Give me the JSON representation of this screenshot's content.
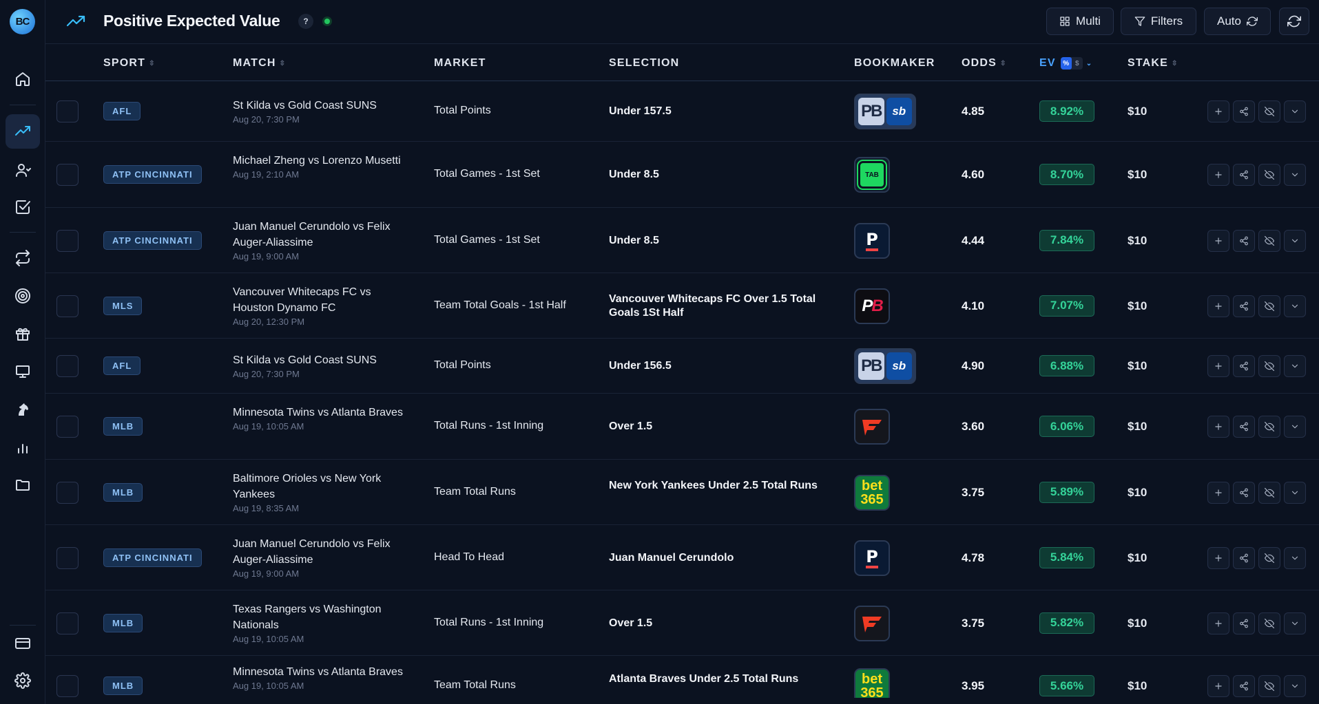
{
  "app": {
    "logo_text": "BC"
  },
  "header": {
    "title": "Positive Expected Value",
    "help_label": "?",
    "buttons": {
      "multi": "Multi",
      "filters": "Filters",
      "auto": "Auto"
    }
  },
  "sidebar": {
    "items": [
      {
        "icon": "home-icon",
        "active": false
      },
      {
        "icon": "trending-up-icon",
        "active": true
      },
      {
        "icon": "user-icon",
        "active": false
      },
      {
        "icon": "check-square-icon",
        "active": false
      },
      {
        "icon": "repeat-icon",
        "active": false
      },
      {
        "icon": "target-icon",
        "active": false
      },
      {
        "icon": "gift-icon",
        "active": false
      },
      {
        "icon": "monitor-icon",
        "active": false
      },
      {
        "icon": "horse-icon",
        "active": false
      },
      {
        "icon": "bar-chart-icon",
        "active": false
      },
      {
        "icon": "folder-icon",
        "active": false
      }
    ],
    "bottom": [
      {
        "icon": "credit-card-icon"
      },
      {
        "icon": "settings-icon"
      }
    ]
  },
  "table": {
    "columns": {
      "sport": "SPORT",
      "match": "MATCH",
      "market": "MARKET",
      "selection": "SELECTION",
      "bookmaker": "BOOKMAKER",
      "odds": "ODDS",
      "ev": "EV",
      "stake": "STAKE"
    },
    "ev_toggle": {
      "percent": "%",
      "dollar": "$"
    },
    "rows": [
      {
        "sport": "AFL",
        "match": "St Kilda vs Gold Coast SUNS",
        "time": "Aug 20, 7:30 PM",
        "market": "Total Points",
        "selection": "Under 157.5",
        "bookmaker": "pointsbet-sportsbet",
        "odds": "4.85",
        "ev": "8.92%",
        "stake": "$10"
      },
      {
        "sport": "ATP CINCINNATI",
        "match": "Michael Zheng vs Lorenzo Musetti",
        "time": "Aug 19, 2:10 AM",
        "market": "Total Games - 1st Set",
        "selection": "Under 8.5",
        "bookmaker": "tab",
        "odds": "4.60",
        "ev": "8.70%",
        "stake": "$10"
      },
      {
        "sport": "ATP CINCINNATI",
        "match": "Juan Manuel Cerundolo vs Felix Auger-Aliassime",
        "time": "Aug 19, 9:00 AM",
        "market": "Total Games - 1st Set",
        "selection": "Under 8.5",
        "bookmaker": "p",
        "odds": "4.44",
        "ev": "7.84%",
        "stake": "$10"
      },
      {
        "sport": "MLS",
        "match": "Vancouver Whitecaps FC vs Houston Dynamo FC",
        "time": "Aug 20, 12:30 PM",
        "market": "Team Total Goals - 1st Half",
        "selection": "Vancouver Whitecaps FC Over 1.5 Total Goals 1St Half",
        "bookmaker": "pb",
        "odds": "4.10",
        "ev": "7.07%",
        "stake": "$10"
      },
      {
        "sport": "AFL",
        "match": "St Kilda vs Gold Coast SUNS",
        "time": "Aug 20, 7:30 PM",
        "market": "Total Points",
        "selection": "Under 156.5",
        "bookmaker": "pointsbet-sportsbet",
        "odds": "4.90",
        "ev": "6.88%",
        "stake": "$10"
      },
      {
        "sport": "MLB",
        "match": "Minnesota Twins vs Atlanta Braves",
        "time": "Aug 19, 10:05 AM",
        "market": "Total Runs - 1st Inning",
        "selection": "Over 1.5",
        "bookmaker": "fanduel",
        "odds": "3.60",
        "ev": "6.06%",
        "stake": "$10"
      },
      {
        "sport": "MLB",
        "match": "Baltimore Orioles vs New York Yankees",
        "time": "Aug 19, 8:35 AM",
        "market": "Team Total Runs",
        "selection": "New York Yankees Under 2.5 Total Runs",
        "bookmaker": "bet365",
        "odds": "3.75",
        "ev": "5.89%",
        "stake": "$10"
      },
      {
        "sport": "ATP CINCINNATI",
        "match": "Juan Manuel Cerundolo vs Felix Auger-Aliassime",
        "time": "Aug 19, 9:00 AM",
        "market": "Head To Head",
        "selection": "Juan Manuel Cerundolo",
        "bookmaker": "p",
        "odds": "4.78",
        "ev": "5.84%",
        "stake": "$10"
      },
      {
        "sport": "MLB",
        "match": "Texas Rangers vs Washington Nationals",
        "time": "Aug 19, 10:05 AM",
        "market": "Total Runs - 1st Inning",
        "selection": "Over 1.5",
        "bookmaker": "fanduel",
        "odds": "3.75",
        "ev": "5.82%",
        "stake": "$10"
      },
      {
        "sport": "MLB",
        "match": "Minnesota Twins vs Atlanta Braves",
        "time": "Aug 19, 10:05 AM",
        "market": "Team Total Runs",
        "selection": "Atlanta Braves Under 2.5 Total Runs",
        "bookmaker": "bet365",
        "odds": "3.95",
        "ev": "5.66%",
        "stake": "$10"
      }
    ]
  },
  "bookmaker_logos": {
    "pointsbet_text": "PB",
    "sportsbet_text": "sb",
    "tab_text": "TAB",
    "p_text": "P",
    "pb_text": "PB",
    "bet365_top": "bet",
    "bet365_bottom": "365"
  },
  "colors": {
    "accent": "#38bdf8",
    "ev_green": "#34d399",
    "badge_blue": "#8fc1f5",
    "background": "#0b1220"
  }
}
